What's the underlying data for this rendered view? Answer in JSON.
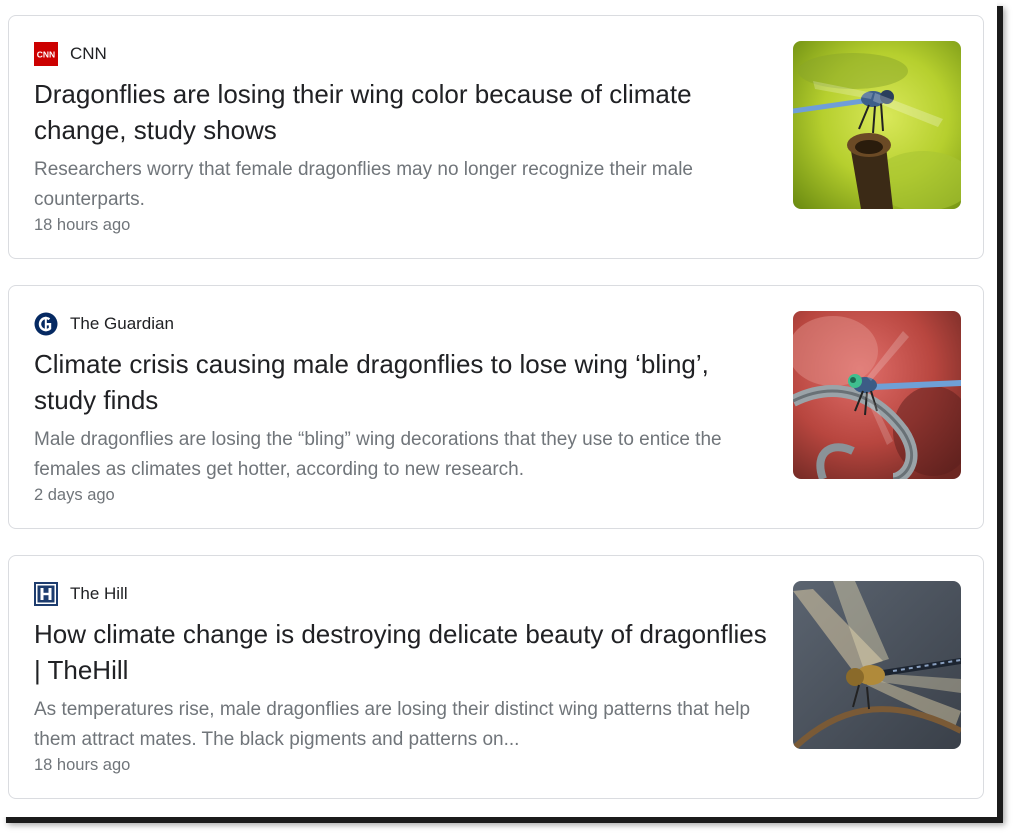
{
  "articles": [
    {
      "source": "CNN",
      "logo_icon": "cnn-logo-icon",
      "headline": "Dragonflies are losing their wing color because of climate change, study shows",
      "snippet": "Researchers worry that female dragonflies may no longer recognize their male counterparts.",
      "time": "18 hours ago"
    },
    {
      "source": "The Guardian",
      "logo_icon": "guardian-logo-icon",
      "headline": "Climate crisis causing male dragonflies to lose wing ‘bling’, study finds",
      "snippet": "Male dragonflies are losing the “bling” wing decorations that they use to entice the females as climates get hotter, according to new research.",
      "time": "2 days ago"
    },
    {
      "source": "The Hill",
      "logo_icon": "the-hill-logo-icon",
      "headline": "How climate change is destroying delicate beauty of dragonflies | TheHill",
      "snippet": "As temperatures rise, male dragonflies are losing their distinct wing patterns that help them attract mates. The black pigments and patterns on...",
      "time": "18 hours ago"
    }
  ],
  "colors": {
    "card_border": "#dadce0",
    "headline": "#202124",
    "meta": "#70757a",
    "cnn_red": "#cc0000",
    "guardian_blue": "#052962",
    "hill_blue": "#1d3c6e"
  }
}
